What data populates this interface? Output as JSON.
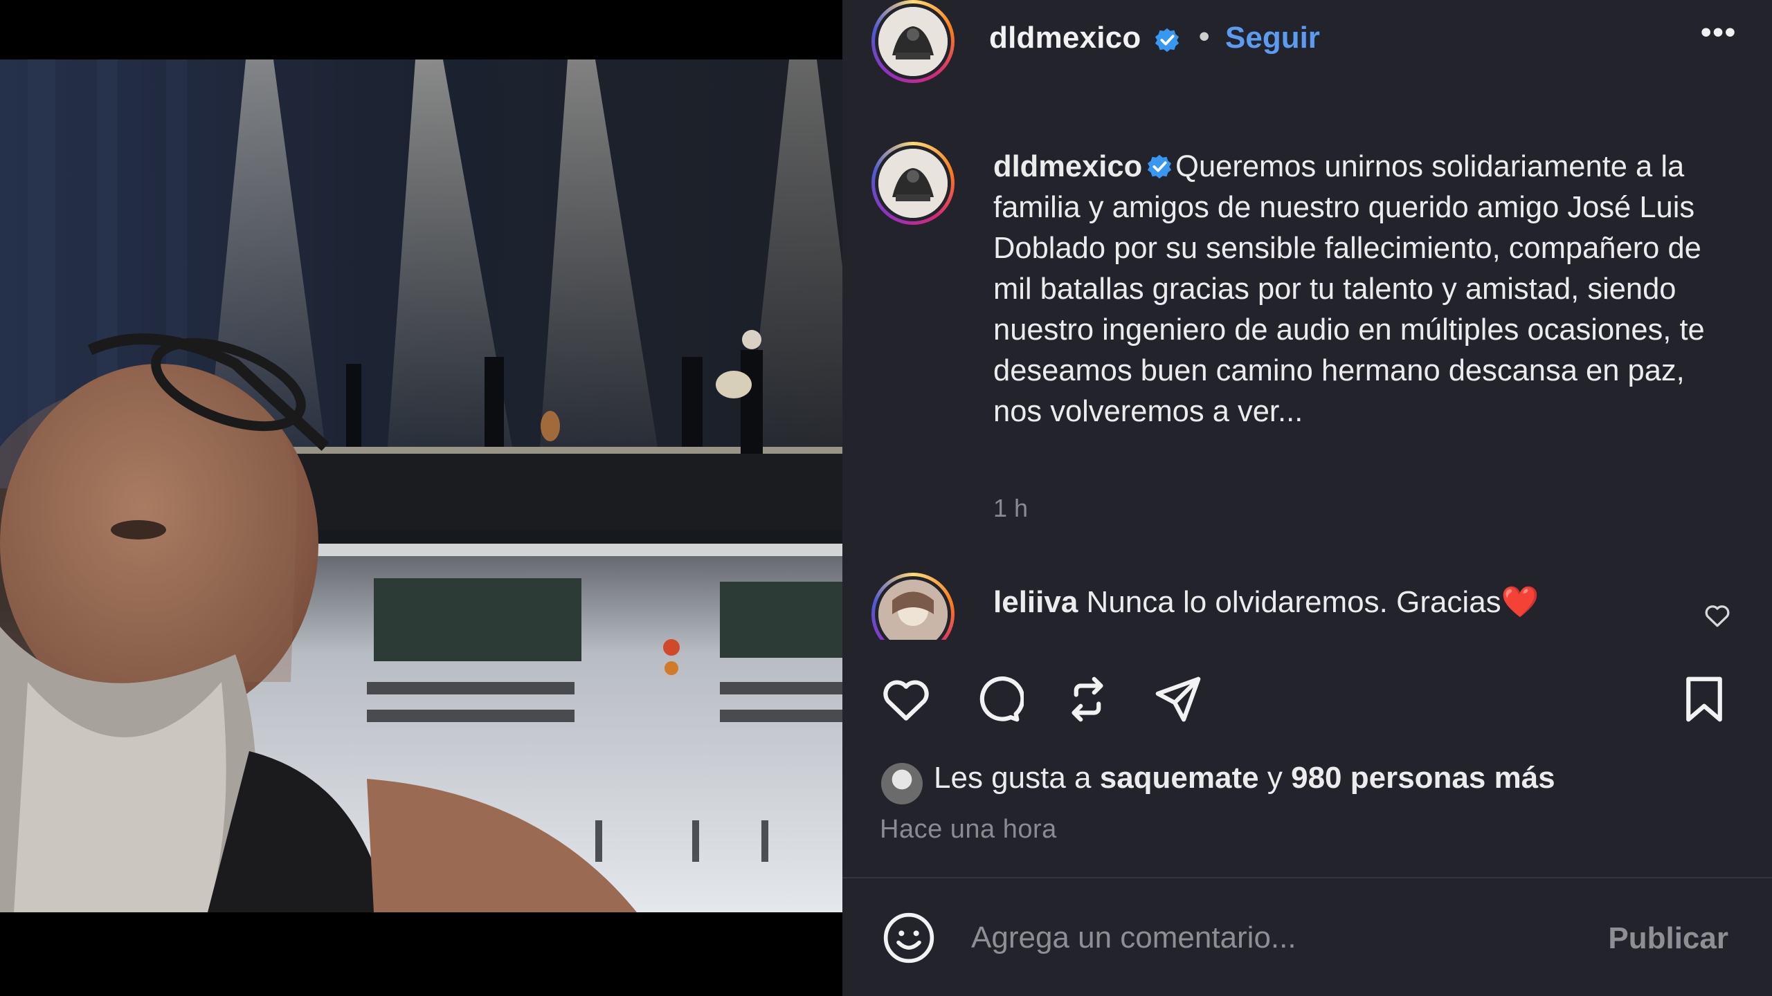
{
  "header": {
    "username": "dldmexico",
    "separator": "•",
    "follow_label": "Seguir",
    "more_label": "•••"
  },
  "caption": {
    "username": "dldmexico",
    "text": "Queremos unirnos solidariamente a la familia y amigos de nuestro querido amigo José Luis Doblado por su sensible fallecimiento, compañero de mil batallas gracias por tu talento y amistad, siendo nuestro ingeniero de audio en múltiples ocasiones, te deseamos buen camino hermano descansa en paz, nos volveremos a ver...",
    "time": "1 h"
  },
  "comment": {
    "username": "leliiva",
    "text": "Nunca lo olvidaremos. Gracias",
    "emoji": "❤️"
  },
  "actions": {
    "like_icon": "heart-icon",
    "comment_icon": "comment-bubble-icon",
    "repost_icon": "repost-icon",
    "share_icon": "send-icon",
    "save_icon": "bookmark-icon"
  },
  "likes": {
    "prefix": "Les gusta a",
    "user": "saquemate",
    "connector": "y",
    "others": "980 personas más"
  },
  "posted_ago": "Hace una hora",
  "composer": {
    "placeholder": "Agrega un comentario...",
    "publish_label": "Publicar"
  },
  "colors": {
    "panel_bg": "#23242b",
    "accent_blue": "#5b9cf2",
    "verified_blue": "#3897f0",
    "heart_red": "#e8332f"
  }
}
